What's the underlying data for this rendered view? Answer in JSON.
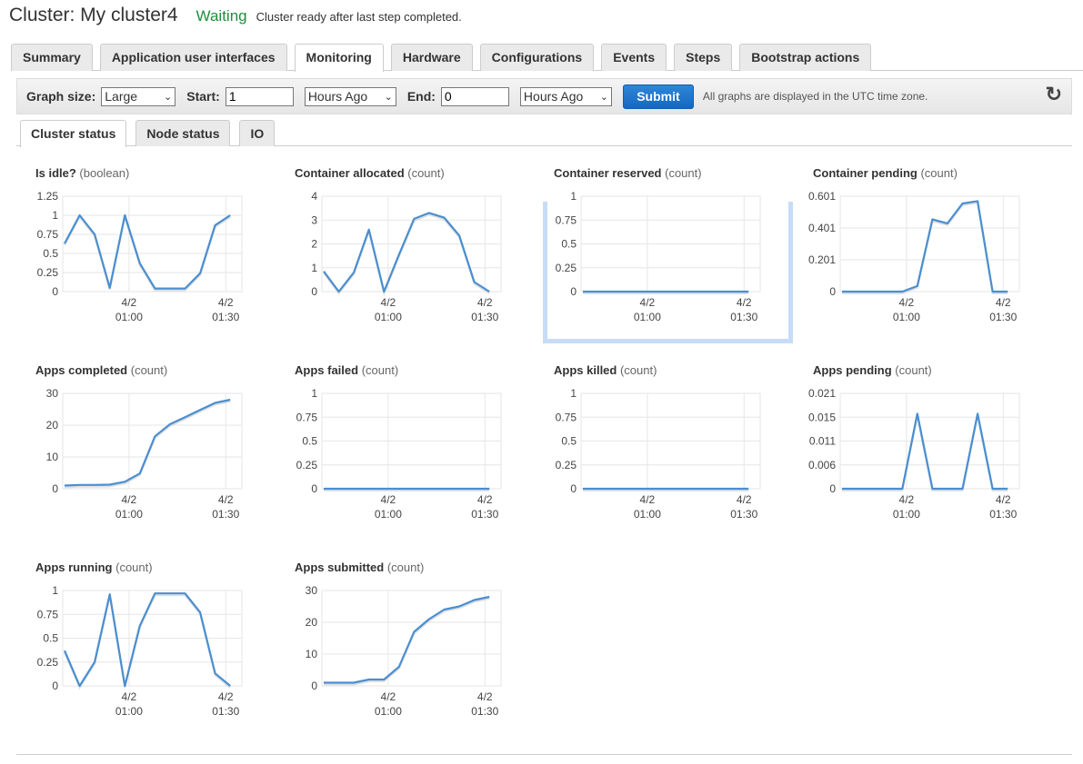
{
  "header": {
    "cluster_title": "Cluster: My cluster4",
    "status": "Waiting",
    "status_message": "Cluster ready after last step completed.",
    "status_color": "#1e8e3e"
  },
  "tabs": [
    {
      "label": "Summary",
      "active": false
    },
    {
      "label": "Application user interfaces",
      "active": false
    },
    {
      "label": "Monitoring",
      "active": true
    },
    {
      "label": "Hardware",
      "active": false
    },
    {
      "label": "Configurations",
      "active": false
    },
    {
      "label": "Events",
      "active": false
    },
    {
      "label": "Steps",
      "active": false
    },
    {
      "label": "Bootstrap actions",
      "active": false
    }
  ],
  "toolbar": {
    "graph_size_label": "Graph size:",
    "graph_size_value": "Large",
    "start_label": "Start:",
    "start_value": "1",
    "start_unit": "Hours Ago",
    "end_label": "End:",
    "end_value": "0",
    "end_unit": "Hours Ago",
    "submit_label": "Submit",
    "timezone_note": "All graphs are displayed in the UTC time zone.",
    "refresh_icon": "refresh-icon"
  },
  "subtabs": [
    {
      "label": "Cluster status",
      "active": true
    },
    {
      "label": "Node status",
      "active": false
    },
    {
      "label": "IO",
      "active": false
    }
  ],
  "chart_data": [
    {
      "type": "line",
      "title": "Is idle?",
      "unit": "(boolean)",
      "yticks": [
        "1.25",
        "1",
        "0.75",
        "0.5",
        "0.25",
        "0"
      ],
      "ylim": [
        0,
        1.25
      ],
      "xticks": [
        {
          "date": "4/2",
          "time": "01:00"
        },
        {
          "date": "4/2",
          "time": "01:30"
        }
      ],
      "values": [
        0.63,
        1,
        0.75,
        0.05,
        1,
        0.37,
        0.04,
        0.04,
        0.04,
        0.24,
        0.87,
        1
      ]
    },
    {
      "type": "line",
      "title": "Container allocated",
      "unit": "(count)",
      "yticks": [
        "4",
        "3",
        "2",
        "1",
        "0"
      ],
      "ylim": [
        0,
        4
      ],
      "xticks": [
        {
          "date": "4/2",
          "time": "01:00"
        },
        {
          "date": "4/2",
          "time": "01:30"
        }
      ],
      "values": [
        0.85,
        0,
        0.8,
        2.6,
        0,
        1.55,
        3.05,
        3.3,
        3.1,
        2.35,
        0.4,
        0
      ]
    },
    {
      "type": "line",
      "title": "Container reserved",
      "unit": "(count)",
      "yticks": [
        "1",
        "0.75",
        "0.5",
        "0.25",
        "0"
      ],
      "ylim": [
        0,
        1
      ],
      "xticks": [
        {
          "date": "4/2",
          "time": "01:00"
        },
        {
          "date": "4/2",
          "time": "01:30"
        }
      ],
      "values": [
        0,
        0,
        0,
        0,
        0,
        0,
        0,
        0,
        0,
        0,
        0,
        0
      ]
    },
    {
      "type": "line",
      "title": "Container pending",
      "unit": "(count)",
      "yticks": [
        "0.601",
        "0.401",
        "0.201",
        "0"
      ],
      "ylim": [
        0,
        0.601
      ],
      "xticks": [
        {
          "date": "4/2",
          "time": "01:00"
        },
        {
          "date": "4/2",
          "time": "01:30"
        }
      ],
      "values": [
        0,
        0,
        0,
        0,
        0,
        0.035,
        0.455,
        0.43,
        0.555,
        0.57,
        0,
        0
      ]
    },
    {
      "type": "line",
      "title": "Apps completed",
      "unit": "(count)",
      "yticks": [
        "30",
        "20",
        "10",
        "0"
      ],
      "ylim": [
        0,
        30
      ],
      "xticks": [
        {
          "date": "4/2",
          "time": "01:00"
        },
        {
          "date": "4/2",
          "time": "01:30"
        }
      ],
      "values": [
        1,
        1.2,
        1.2,
        1.3,
        2.2,
        4.8,
        16.5,
        20.3,
        22.5,
        24.8,
        27,
        28
      ]
    },
    {
      "type": "line",
      "title": "Apps failed",
      "unit": "(count)",
      "yticks": [
        "1",
        "0.75",
        "0.5",
        "0.25",
        "0"
      ],
      "ylim": [
        0,
        1
      ],
      "xticks": [
        {
          "date": "4/2",
          "time": "01:00"
        },
        {
          "date": "4/2",
          "time": "01:30"
        }
      ],
      "values": [
        0,
        0,
        0,
        0,
        0,
        0,
        0,
        0,
        0,
        0,
        0,
        0
      ]
    },
    {
      "type": "line",
      "title": "Apps killed",
      "unit": "(count)",
      "yticks": [
        "1",
        "0.75",
        "0.5",
        "0.25",
        "0"
      ],
      "ylim": [
        0,
        1
      ],
      "xticks": [
        {
          "date": "4/2",
          "time": "01:00"
        },
        {
          "date": "4/2",
          "time": "01:30"
        }
      ],
      "values": [
        0,
        0,
        0,
        0,
        0,
        0,
        0,
        0,
        0,
        0,
        0,
        0
      ]
    },
    {
      "type": "line",
      "title": "Apps pending",
      "unit": "(count)",
      "yticks": [
        "0.021",
        "0.015",
        "0.011",
        "0.006",
        "0"
      ],
      "ylim": [
        0,
        0.021
      ],
      "xticks": [
        {
          "date": "4/2",
          "time": "01:00"
        },
        {
          "date": "4/2",
          "time": "01:30"
        }
      ],
      "values": [
        0,
        0,
        0,
        0,
        0,
        0.0165,
        0,
        0,
        0,
        0.0165,
        0,
        0
      ]
    },
    {
      "type": "line",
      "title": "Apps running",
      "unit": "(count)",
      "yticks": [
        "1",
        "0.75",
        "0.5",
        "0.25",
        "0"
      ],
      "ylim": [
        0,
        1
      ],
      "xticks": [
        {
          "date": "4/2",
          "time": "01:00"
        },
        {
          "date": "4/2",
          "time": "01:30"
        }
      ],
      "values": [
        0.37,
        0,
        0.25,
        0.96,
        0,
        0.63,
        0.97,
        0.97,
        0.97,
        0.77,
        0.13,
        0
      ]
    },
    {
      "type": "line",
      "title": "Apps submitted",
      "unit": "(count)",
      "yticks": [
        "30",
        "20",
        "10",
        "0"
      ],
      "ylim": [
        0,
        30
      ],
      "xticks": [
        {
          "date": "4/2",
          "time": "01:00"
        },
        {
          "date": "4/2",
          "time": "01:30"
        }
      ],
      "values": [
        1,
        1,
        1,
        2,
        2,
        6,
        17,
        21,
        24,
        25,
        27,
        28
      ]
    }
  ]
}
